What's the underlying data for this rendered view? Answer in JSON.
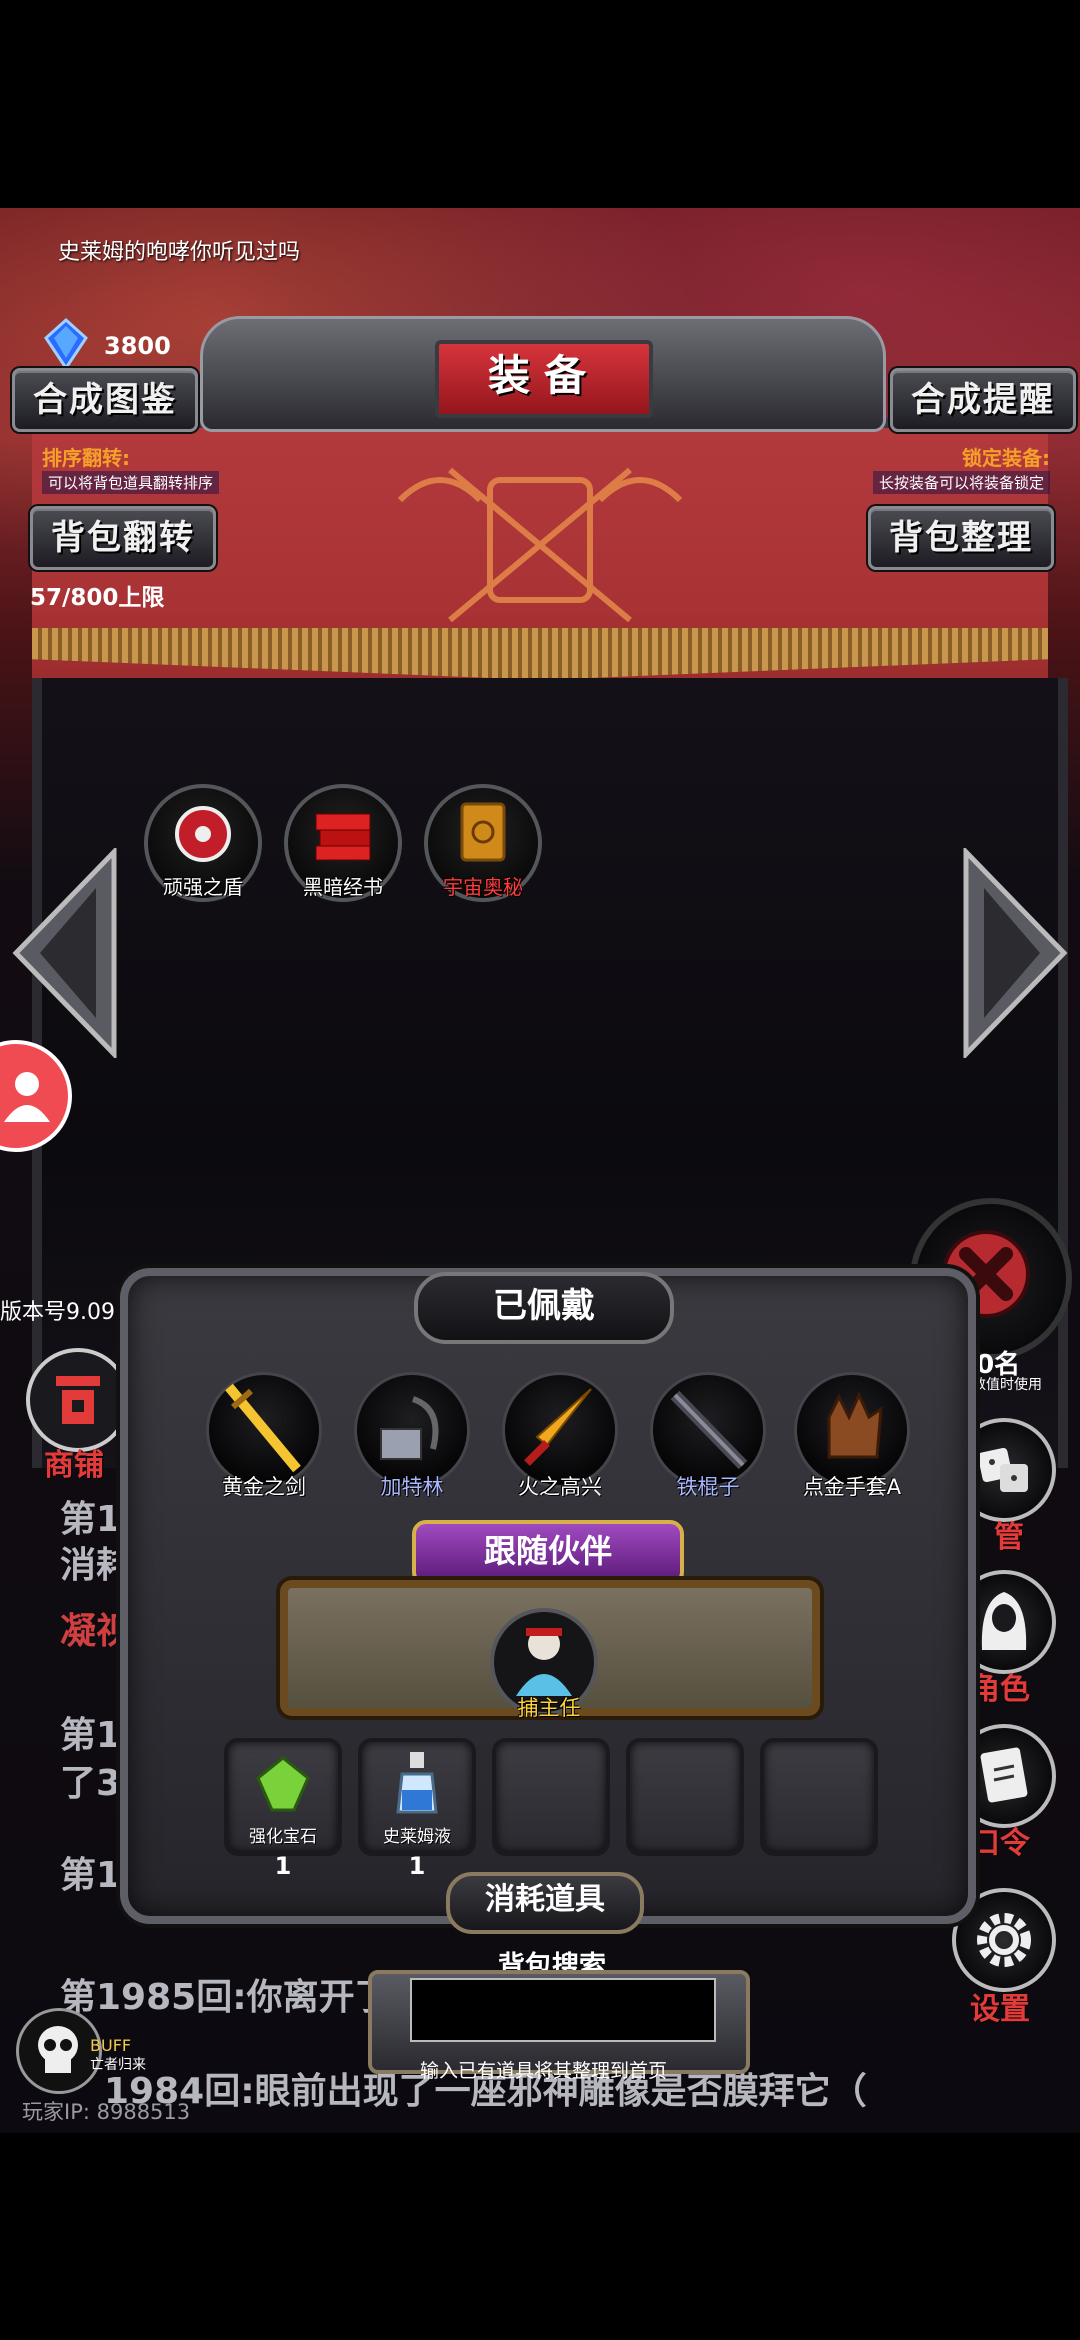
{
  "header": {
    "top_text": "史莱姆的咆哮你听见过吗",
    "gem_count": "3800",
    "title": "装备",
    "left_button": "合成图鉴",
    "right_button": "合成提醒"
  },
  "hints": {
    "left_title": "排序翻转:",
    "left_sub": "可以将背包道具翻转排序",
    "right_title": "锁定装备:",
    "right_sub": "长按装备可以将装备锁定"
  },
  "actions": {
    "flip": "背包翻转",
    "sort": "背包整理",
    "capacity": "57/800上限"
  },
  "bag_items": [
    {
      "label": "顽强之盾",
      "color": "#ffffff"
    },
    {
      "label": "黑暗经书",
      "color": "#ffffff"
    },
    {
      "label": "宇宙奥秘",
      "color": "#ff3b3b"
    }
  ],
  "version": "版本号9.09",
  "shop_label": "商铺",
  "equipped": {
    "title": "已佩戴",
    "items": [
      {
        "label": "黄金之剑",
        "color": "#ffffff"
      },
      {
        "label": "加特林",
        "color": "#a9b7ff"
      },
      {
        "label": "火之高兴",
        "color": "#ffffff"
      },
      {
        "label": "铁棍子",
        "color": "#a9b7ff"
      },
      {
        "label": "点金手套A",
        "color": "#ffffff"
      }
    ]
  },
  "partner": {
    "title": "跟随伙伴",
    "name": "捕主任"
  },
  "consumables": {
    "title": "消耗道具",
    "items": [
      {
        "label": "强化宝石",
        "count": "1"
      },
      {
        "label": "史莱姆液",
        "count": "1"
      }
    ]
  },
  "search": {
    "label": "背包搜索",
    "hint": "输入已有道具将其整理到首页"
  },
  "right_menu": {
    "partial_text": "50名",
    "partial_sub": "其数值时使用",
    "manage": "管",
    "role": "角色",
    "command": "口令",
    "settings": "设置"
  },
  "chat_lines": [
    "第1",
    "消耗",
    "凝视者",
    "第1",
    "了3",
    "第1",
    "第1985回:你离开了",
    "1984回:眼前出现了一座邪神雕像是否膜拜它（"
  ],
  "buff": {
    "label": "BUFF",
    "sub": "亡者归来"
  },
  "player_ip": "玩家IP: 8988513",
  "colors": {
    "accent_red": "#e33a3a",
    "hint_orange": "#f4a02a",
    "banner_red": "#b33a3c"
  }
}
